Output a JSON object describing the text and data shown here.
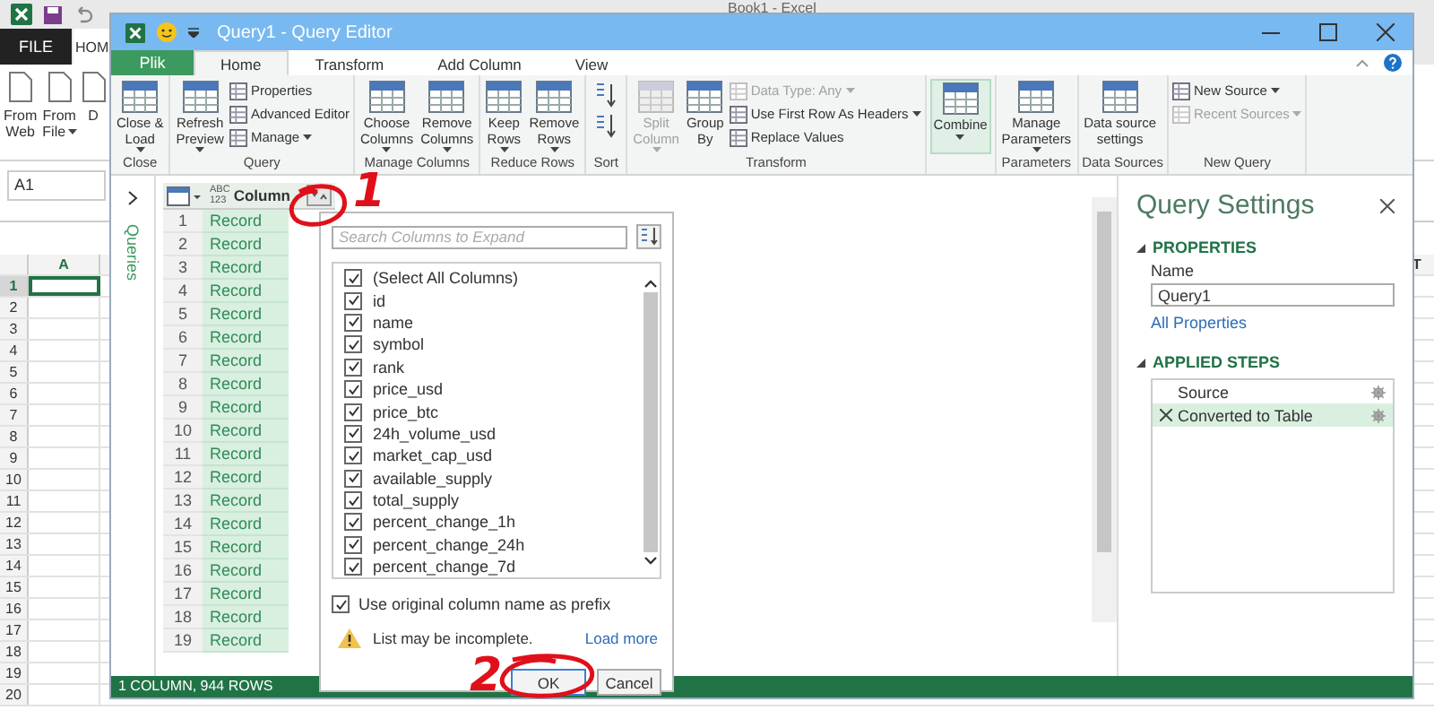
{
  "excel": {
    "title": "Book1 - Excel",
    "file_tab": "FILE",
    "tabs": [
      "HOM"
    ],
    "ribbon": [
      {
        "lines": [
          "From",
          "Web"
        ],
        "dropdown": false
      },
      {
        "lines": [
          "From",
          "File"
        ],
        "dropdown": true
      },
      {
        "lines": [
          "D"
        ],
        "dropdown": false
      }
    ],
    "name_box": "A1",
    "columns": [
      "A"
    ],
    "far_column": "T",
    "rows": [
      {
        "label": "1",
        "selected": true
      },
      {
        "label": "2",
        "selected": false
      },
      {
        "label": "3",
        "selected": false
      },
      {
        "label": "4",
        "selected": false
      },
      {
        "label": "5",
        "selected": false
      },
      {
        "label": "6",
        "selected": false
      },
      {
        "label": "7",
        "selected": false
      },
      {
        "label": "8",
        "selected": false
      },
      {
        "label": "9",
        "selected": false
      },
      {
        "label": "10",
        "selected": false
      },
      {
        "label": "11",
        "selected": false
      },
      {
        "label": "12",
        "selected": false
      },
      {
        "label": "13",
        "selected": false
      },
      {
        "label": "14",
        "selected": false
      },
      {
        "label": "15",
        "selected": false
      },
      {
        "label": "16",
        "selected": false
      },
      {
        "label": "17",
        "selected": false
      },
      {
        "label": "18",
        "selected": false
      },
      {
        "label": "19",
        "selected": false
      },
      {
        "label": "20",
        "selected": false
      }
    ]
  },
  "editor": {
    "title": "Query1 - Query Editor",
    "file_tab": "Plik",
    "tabs": [
      {
        "label": "Home",
        "selected": true
      },
      {
        "label": "Transform",
        "selected": false
      },
      {
        "label": "Add Column",
        "selected": false
      },
      {
        "label": "View",
        "selected": false
      }
    ],
    "ribbon": [
      {
        "label": "Close",
        "items": [
          {
            "kind": "large",
            "lines": [
              "Close &",
              "Load"
            ],
            "dropdown": true,
            "disabled": false,
            "highlighted": false
          }
        ]
      },
      {
        "label": "Query",
        "items": [
          {
            "kind": "large",
            "lines": [
              "Refresh",
              "Preview"
            ],
            "dropdown": true,
            "disabled": false,
            "highlighted": false
          },
          {
            "kind": "stack",
            "items": [
              {
                "label": "Properties",
                "dropdown": false,
                "disabled": false
              },
              {
                "label": "Advanced Editor",
                "dropdown": false,
                "disabled": false
              },
              {
                "label": "Manage",
                "dropdown": true,
                "disabled": false
              }
            ]
          }
        ]
      },
      {
        "label": "Manage Columns",
        "items": [
          {
            "kind": "large",
            "lines": [
              "Choose",
              "Columns"
            ],
            "dropdown": true,
            "disabled": false,
            "highlighted": false
          },
          {
            "kind": "large",
            "lines": [
              "Remove",
              "Columns"
            ],
            "dropdown": true,
            "disabled": false,
            "highlighted": false
          }
        ]
      },
      {
        "label": "Reduce Rows",
        "items": [
          {
            "kind": "large",
            "lines": [
              "Keep",
              "Rows"
            ],
            "dropdown": true,
            "disabled": false,
            "highlighted": false
          },
          {
            "kind": "large",
            "lines": [
              "Remove",
              "Rows"
            ],
            "dropdown": true,
            "disabled": false,
            "highlighted": false
          }
        ]
      },
      {
        "label": "Sort",
        "items": [
          {
            "kind": "sort"
          }
        ]
      },
      {
        "label": "Transform",
        "items": [
          {
            "kind": "large",
            "lines": [
              "Split",
              "Column"
            ],
            "dropdown": true,
            "disabled": true,
            "highlighted": false
          },
          {
            "kind": "large",
            "lines": [
              "Group",
              "By"
            ],
            "dropdown": false,
            "disabled": false,
            "highlighted": false
          },
          {
            "kind": "stack",
            "items": [
              {
                "label": "Data Type: Any",
                "dropdown": true,
                "disabled": true
              },
              {
                "label": "Use First Row As Headers",
                "dropdown": true,
                "disabled": false
              },
              {
                "label": "Replace Values",
                "dropdown": false,
                "disabled": false
              }
            ]
          }
        ]
      },
      {
        "items": [
          {
            "kind": "large",
            "lines": [
              "Combine"
            ],
            "dropdown": true,
            "disabled": false,
            "highlighted": true
          }
        ]
      },
      {
        "label": "Parameters",
        "items": [
          {
            "kind": "large",
            "lines": [
              "Manage",
              "Parameters"
            ],
            "dropdown": true,
            "disabled": false,
            "highlighted": false
          }
        ]
      },
      {
        "label": "Data Sources",
        "items": [
          {
            "kind": "large",
            "lines": [
              "Data source",
              "settings"
            ],
            "dropdown": false,
            "disabled": false,
            "highlighted": false
          }
        ]
      },
      {
        "label": "New Query",
        "items": [
          {
            "kind": "stack",
            "items": [
              {
                "label": "New Source",
                "dropdown": true,
                "disabled": false
              },
              {
                "label": "Recent Sources",
                "dropdown": true,
                "disabled": true
              }
            ]
          }
        ]
      }
    ],
    "queries_label": "Queries",
    "table": {
      "type_lines": [
        "ABC",
        "123"
      ],
      "column": "Column",
      "rows": [
        {
          "num": "1",
          "value": "Record"
        },
        {
          "num": "2",
          "value": "Record"
        },
        {
          "num": "3",
          "value": "Record"
        },
        {
          "num": "4",
          "value": "Record"
        },
        {
          "num": "5",
          "value": "Record"
        },
        {
          "num": "6",
          "value": "Record"
        },
        {
          "num": "7",
          "value": "Record"
        },
        {
          "num": "8",
          "value": "Record"
        },
        {
          "num": "9",
          "value": "Record"
        },
        {
          "num": "10",
          "value": "Record"
        },
        {
          "num": "11",
          "value": "Record"
        },
        {
          "num": "12",
          "value": "Record"
        },
        {
          "num": "13",
          "value": "Record"
        },
        {
          "num": "14",
          "value": "Record"
        },
        {
          "num": "15",
          "value": "Record"
        },
        {
          "num": "16",
          "value": "Record"
        },
        {
          "num": "17",
          "value": "Record"
        },
        {
          "num": "18",
          "value": "Record"
        },
        {
          "num": "19",
          "value": "Record"
        }
      ]
    },
    "status": "1 COLUMN, 944 ROWS",
    "settings": {
      "title": "Query Settings",
      "properties_heading": "PROPERTIES",
      "name_label": "Name",
      "name_value": "Query1",
      "link": "All Properties",
      "steps_heading": "APPLIED STEPS",
      "steps": [
        {
          "label": "Source",
          "selected": false
        },
        {
          "label": "Converted to Table",
          "selected": true
        }
      ]
    },
    "expand_dialog": {
      "placeholder": "Search Columns to Expand",
      "items": [
        {
          "label": "(Select All Columns)",
          "checked": true
        },
        {
          "label": "id",
          "checked": true
        },
        {
          "label": "name",
          "checked": true
        },
        {
          "label": "symbol",
          "checked": true
        },
        {
          "label": "rank",
          "checked": true
        },
        {
          "label": "price_usd",
          "checked": true
        },
        {
          "label": "price_btc",
          "checked": true
        },
        {
          "label": "24h_volume_usd",
          "checked": true
        },
        {
          "label": "market_cap_usd",
          "checked": true
        },
        {
          "label": "available_supply",
          "checked": true
        },
        {
          "label": "total_supply",
          "checked": true
        },
        {
          "label": "percent_change_1h",
          "checked": true
        },
        {
          "label": "percent_change_24h",
          "checked": true
        },
        {
          "label": "percent_change_7d",
          "checked": true
        }
      ],
      "prefix": {
        "label": "Use original column name as prefix",
        "checked": true
      },
      "warning": "List may be incomplete.",
      "load_more": "Load more",
      "buttons": [
        {
          "label": "OK",
          "selected": true
        },
        {
          "label": "Cancel",
          "selected": false
        }
      ]
    }
  },
  "annotations": [
    {
      "label": "1"
    },
    {
      "label": "2"
    }
  ]
}
